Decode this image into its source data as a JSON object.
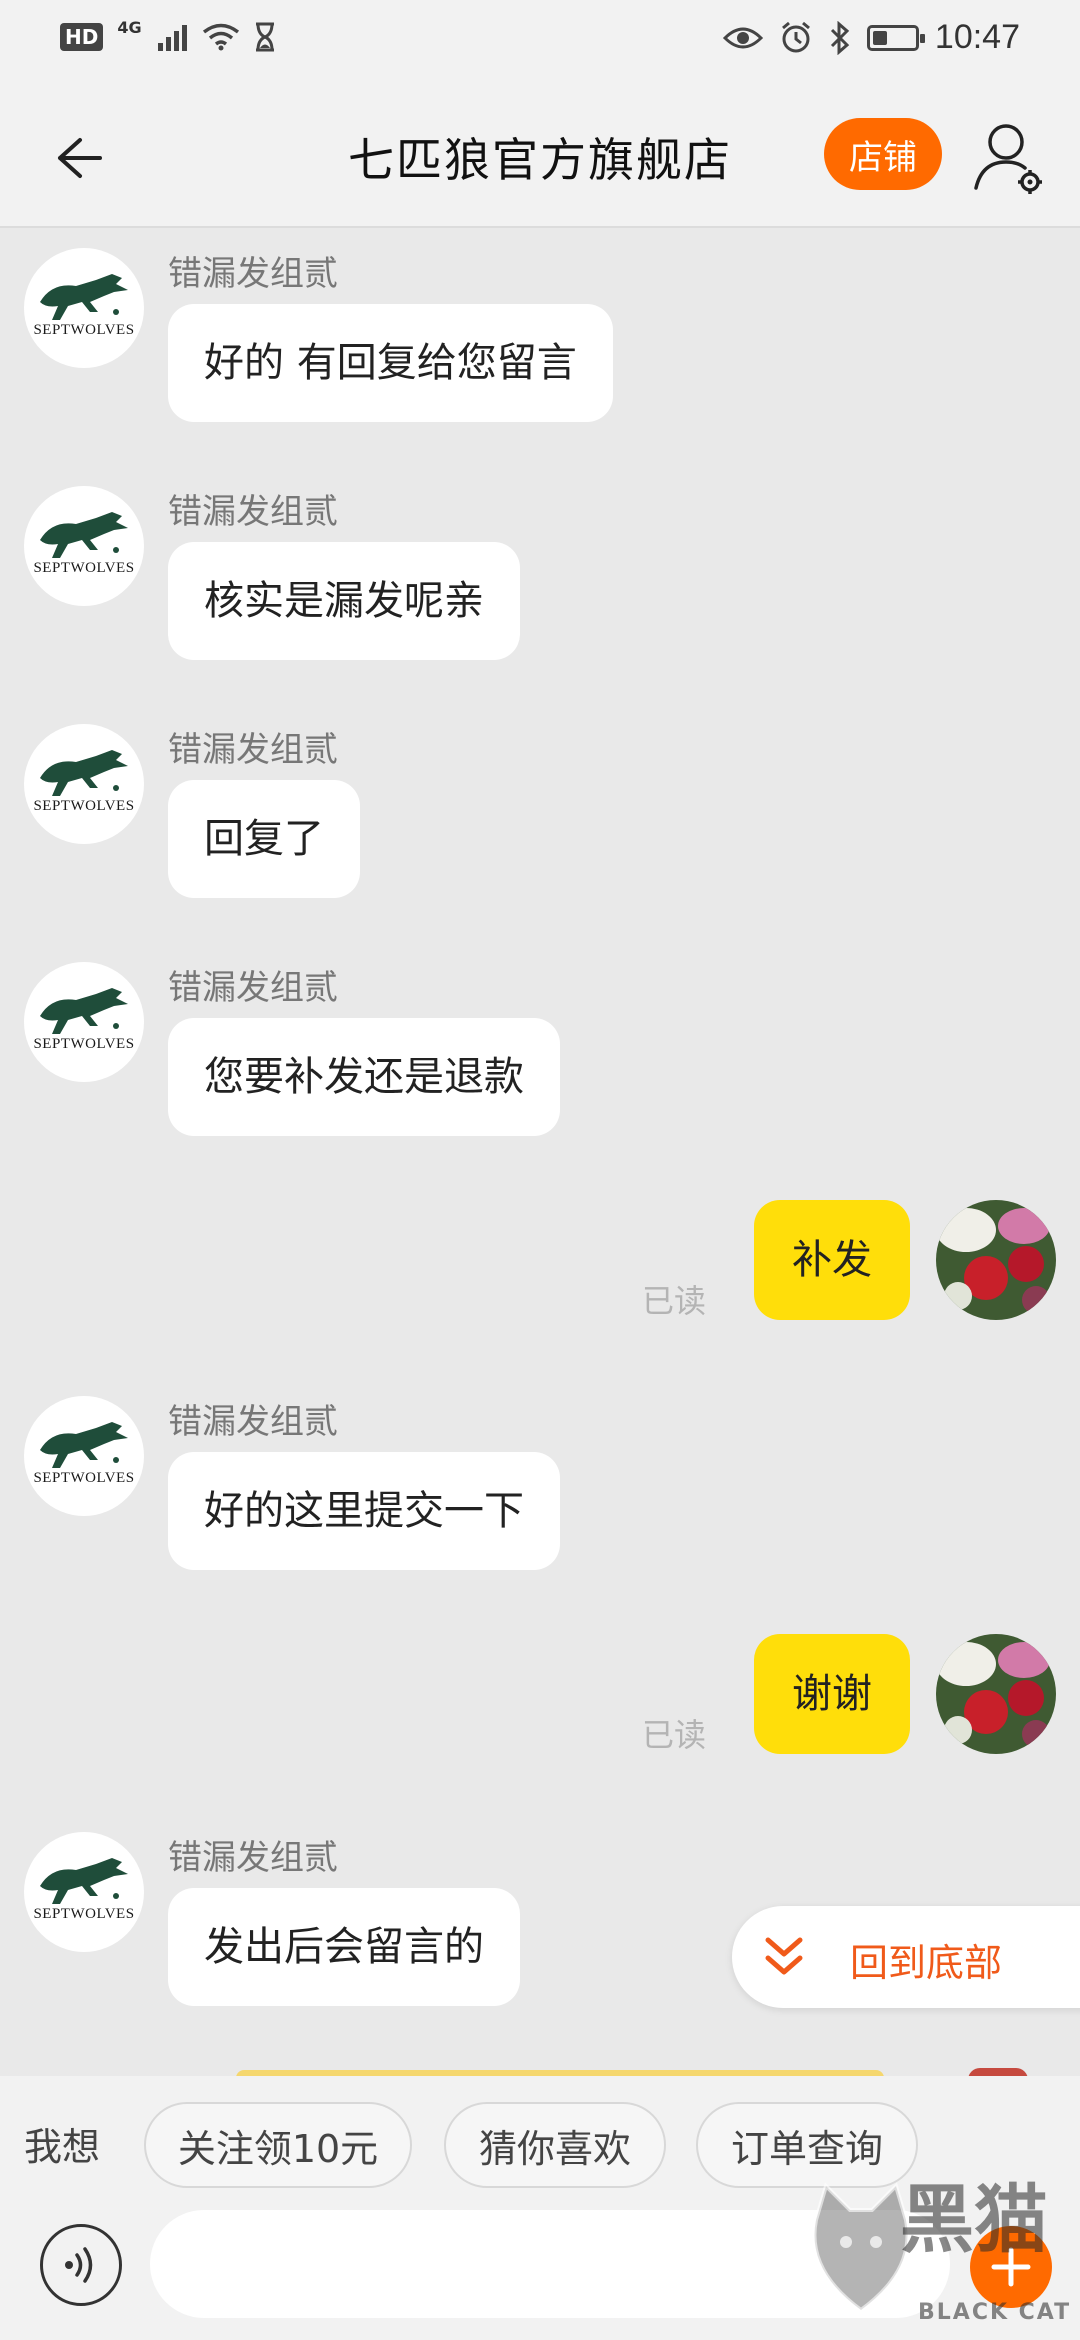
{
  "status_bar": {
    "hd": "HD",
    "network": "4G",
    "time": "10:47",
    "battery_level": 0.3
  },
  "header": {
    "title": "七匹狼官方旗舰店",
    "shop_label": "店铺",
    "icons": [
      "back-arrow-icon",
      "customer-service-settings-icon"
    ]
  },
  "shop_brand": "SEPTWOLVES",
  "read_label": "已读",
  "messages": [
    {
      "from": "shop",
      "sender": "错漏发组贰",
      "text": "好的 有回复给您留言"
    },
    {
      "from": "shop",
      "sender": "错漏发组贰",
      "text": "核实是漏发呢亲"
    },
    {
      "from": "shop",
      "sender": "错漏发组贰",
      "text": "回复了"
    },
    {
      "from": "shop",
      "sender": "错漏发组贰",
      "text": "您要补发还是退款"
    },
    {
      "from": "me",
      "text": "补发",
      "status": "已读"
    },
    {
      "from": "shop",
      "sender": "错漏发组贰",
      "text": "好的这里提交一下"
    },
    {
      "from": "me",
      "text": "谢谢",
      "status": "已读"
    },
    {
      "from": "shop",
      "sender": "错漏发组贰",
      "text": "发出后会留言的"
    }
  ],
  "back_to_bottom": {
    "label": "回到底部",
    "icon": "double-chevron-down-icon"
  },
  "quick_bar": {
    "label": "我想",
    "chips": [
      "关注领10元",
      "猜你喜欢",
      "订单查询"
    ]
  },
  "input": {
    "placeholder": "",
    "value": ""
  },
  "watermark": {
    "cn": "黑猫",
    "en": "BLACK CAT"
  },
  "colors": {
    "accent": "#ff6a00",
    "my_bubble": "#ffde0a",
    "back_to_bottom_text": "#f05a1a",
    "chat_background": "#e9e9e9"
  }
}
